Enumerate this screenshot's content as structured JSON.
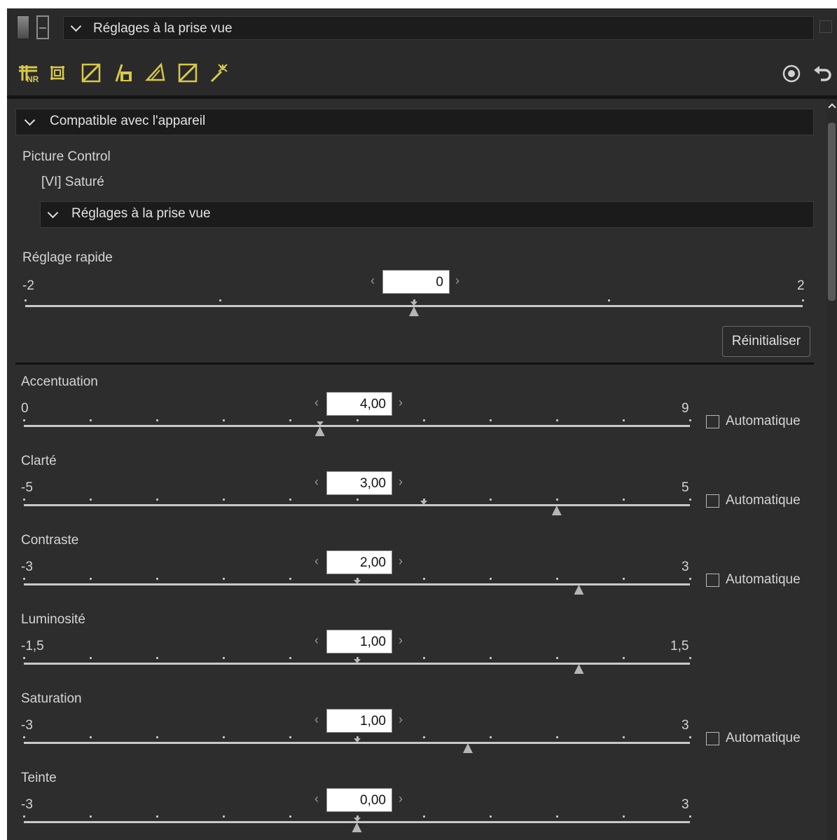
{
  "header": {
    "preset_label": "Réglages à la prise vue",
    "icons": [
      "single-view-icon",
      "split-view-icon",
      "chevron-down-icon",
      "panel-toggle-icon"
    ]
  },
  "toolbar": {
    "tools": [
      "noise-reduction-icon",
      "crop-icon",
      "tone-curve-icon",
      "levels-icon",
      "perspective-icon",
      "color-curve-icon",
      "auto-retouch-wand-icon"
    ],
    "right_icons": [
      "reset-adjustments-icon",
      "undo-icon"
    ],
    "accent": "#d8c84a"
  },
  "compat_section": {
    "title": "Compatible avec l'appareil",
    "picture_control_label": "Picture Control",
    "picture_control_value": "[VI] Saturé",
    "sub_section_title": "Réglages à la prise vue"
  },
  "quick": {
    "label": "Réglage rapide",
    "min": "-2",
    "max": "2",
    "value": "0",
    "value_num": 0,
    "default_num": 0,
    "range": [
      -2,
      2
    ],
    "reset_label": "Réinitialiser"
  },
  "sliders": [
    {
      "label": "Accentuation",
      "min": "0",
      "max": "9",
      "value": "4,00",
      "value_num": 4,
      "default_num": 4,
      "range": [
        0,
        9
      ],
      "has_auto": true,
      "auto_label": "Automatique"
    },
    {
      "label": "Clarté",
      "min": "-5",
      "max": "5",
      "value": "3,00",
      "value_num": 3,
      "default_num": 1,
      "range": [
        -5,
        5
      ],
      "has_auto": true,
      "auto_label": "Automatique"
    },
    {
      "label": "Contraste",
      "min": "-3",
      "max": "3",
      "value": "2,00",
      "value_num": 2,
      "default_num": 0,
      "range": [
        -3,
        3
      ],
      "has_auto": true,
      "auto_label": "Automatique"
    },
    {
      "label": "Luminosité",
      "min": "-1,5",
      "max": "1,5",
      "value": "1,00",
      "value_num": 1,
      "default_num": 0,
      "range": [
        -1.5,
        1.5
      ],
      "has_auto": false,
      "auto_label": ""
    },
    {
      "label": "Saturation",
      "min": "-3",
      "max": "3",
      "value": "1,00",
      "value_num": 1,
      "default_num": 0,
      "range": [
        -3,
        3
      ],
      "has_auto": true,
      "auto_label": "Automatique"
    },
    {
      "label": "Teinte",
      "min": "-3",
      "max": "3",
      "value": "0,00",
      "value_num": 0,
      "default_num": 0,
      "range": [
        -3,
        3
      ],
      "has_auto": false,
      "auto_label": ""
    }
  ]
}
